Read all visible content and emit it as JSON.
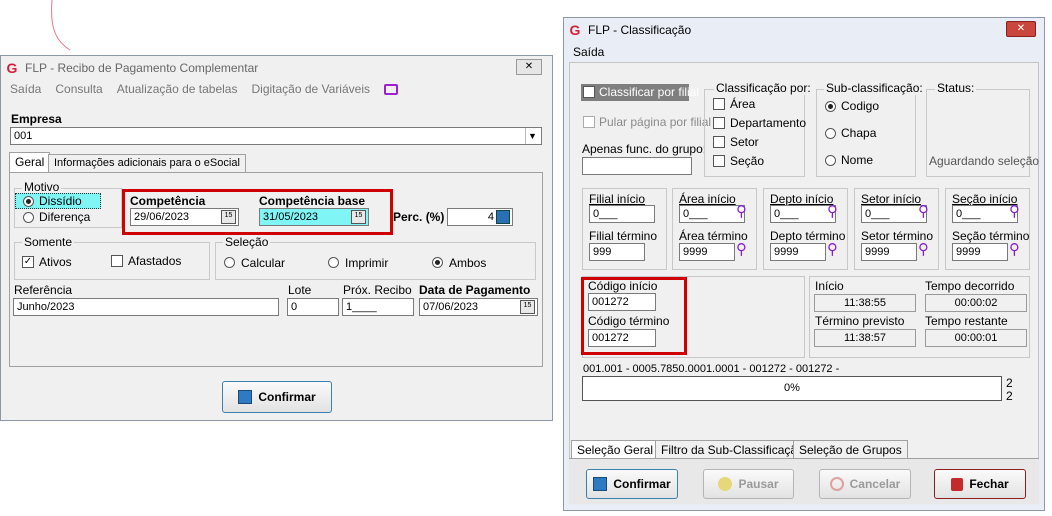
{
  "recibo": {
    "title": "FLP - Recibo de Pagamento Complementar",
    "logo": "G",
    "close": "✕",
    "menu": [
      "Saída",
      "Consulta",
      "Atualização de tabelas",
      "Digitação de Variáveis"
    ],
    "empresa_label": "Empresa",
    "empresa_value": "001",
    "tabs": [
      "Geral",
      "Informações adicionais para o eSocial"
    ],
    "motivo": {
      "label": "Motivo",
      "options": [
        "Dissídio",
        "Diferença"
      ],
      "selected": "Dissídio"
    },
    "competencia": {
      "label": "Competência",
      "value": "29/06/2023"
    },
    "competencia_base": {
      "label": "Competência base",
      "value": "31/05/2023"
    },
    "perc": {
      "label": "Perc. (%)",
      "value": "4"
    },
    "somente": {
      "label": "Somente",
      "ativos": "Ativos",
      "afastados": "Afastados",
      "ativos_checked": true,
      "afastados_checked": false
    },
    "selecao": {
      "label": "Seleção",
      "options": [
        "Calcular",
        "Imprimir",
        "Ambos"
      ],
      "selected": "Ambos"
    },
    "referencia": {
      "label": "Referência",
      "value": "Junho/2023"
    },
    "lote": {
      "label": "Lote",
      "value": "0"
    },
    "prox_recibo": {
      "label": "Próx. Recibo",
      "value": "1____"
    },
    "data_pagamento": {
      "label": "Data de Pagamento",
      "value": "07/06/2023"
    },
    "confirm_button": "Confirmar",
    "cal_icon": "15"
  },
  "classificacao": {
    "title": "FLP - Classificação",
    "logo": "G",
    "close": "✕",
    "menu": [
      "Saída"
    ],
    "classificar_por_filial": "Classificar por filial",
    "pular_pagina": "Pular página por filial",
    "apenas_func_label": "Apenas func. do grupo:",
    "apenas_func_value": "",
    "classificacao_por": {
      "label": "Classificação  por:",
      "options": [
        "Área",
        "Departamento",
        "Setor",
        "Seção"
      ]
    },
    "sub_classificacao": {
      "label": "Sub-classificação:",
      "options": [
        "Codigo",
        "Chapa",
        "Nome"
      ],
      "selected": "Codigo"
    },
    "status": {
      "label": "Status:",
      "value": "Aguardando seleção"
    },
    "ranges": [
      {
        "start_label": "Filial início",
        "start": "0___",
        "end_label": "Filial término",
        "end": "999",
        "search": false
      },
      {
        "start_label": "Área início",
        "start": "0___",
        "end_label": "Área término",
        "end": "9999",
        "search": true
      },
      {
        "start_label": "Depto início",
        "start": "0___",
        "end_label": "Depto término",
        "end": "9999",
        "search": true
      },
      {
        "start_label": "Setor início",
        "start": "0___",
        "end_label": "Setor término",
        "end": "9999",
        "search": true
      },
      {
        "start_label": "Seção início",
        "start": "0___",
        "end_label": "Seção término",
        "end": "9999",
        "search": true
      }
    ],
    "codigo_inicio": {
      "label": "Código início",
      "value": "001272"
    },
    "codigo_termino": {
      "label": "Código término",
      "value": "001272"
    },
    "inicio": {
      "label": "Início",
      "value": "11:38:55"
    },
    "tempo_decorrido": {
      "label": "Tempo decorrido",
      "value": "00:00:02"
    },
    "termino_previsto": {
      "label": "Término previsto",
      "value": "11:38:57"
    },
    "tempo_restante": {
      "label": "Tempo restante",
      "value": "00:00:01"
    },
    "progress_caption": "001.001 - 0005.7850.0001.0001 - 001272 - 001272 -",
    "progress_percent": "0%",
    "progress_fraction": 0,
    "side_numbers": [
      "2",
      "2"
    ],
    "tabs": [
      "Seleção Geral",
      "Filtro da Sub-Classificação",
      "Seleção de Grupos"
    ],
    "buttons": {
      "confirmar": "Confirmar",
      "pausar": "Pausar",
      "cancelar": "Cancelar",
      "fechar": "Fechar"
    }
  },
  "colors": {
    "highlight_red": "#d00000",
    "field_cyan": "#7ff5f5",
    "search_purple": "#8a1fd1"
  }
}
